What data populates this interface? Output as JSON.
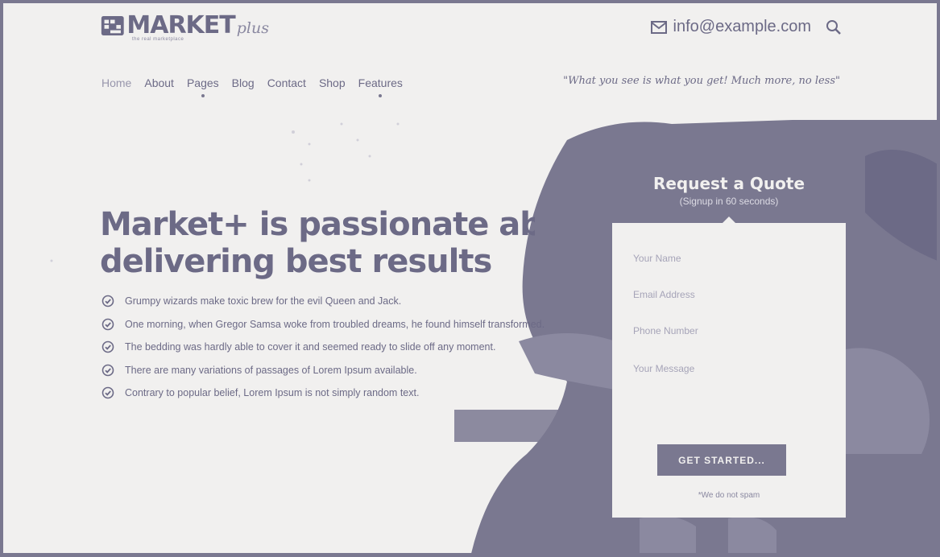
{
  "header": {
    "logo_text": "MARKET",
    "logo_suffix": "plus",
    "logo_tagline": "the real marketplace",
    "email": "info@example.com",
    "tagline": "\"What you see is what you get! Much more, no less\""
  },
  "nav": {
    "items": [
      {
        "label": "Home",
        "has_dropdown": false
      },
      {
        "label": "About",
        "has_dropdown": false
      },
      {
        "label": "Pages",
        "has_dropdown": true
      },
      {
        "label": "Blog",
        "has_dropdown": false
      },
      {
        "label": "Contact",
        "has_dropdown": false
      },
      {
        "label": "Shop",
        "has_dropdown": false
      },
      {
        "label": "Features",
        "has_dropdown": true
      }
    ]
  },
  "hero": {
    "headline_line1": "Market+ is passionate about",
    "headline_line2": "delivering best results",
    "features": [
      "Grumpy wizards make toxic brew for the evil Queen and Jack.",
      "One morning, when Gregor Samsa woke from troubled dreams, he found himself transformed.",
      "The bedding was hardly able to cover it and seemed ready to slide off any moment.",
      "There are many variations of passages of Lorem Ipsum available.",
      "Contrary to popular belief, Lorem Ipsum is not simply random text."
    ]
  },
  "quote_form": {
    "title": "Request a Quote",
    "subtitle": "(Signup in 60 seconds)",
    "name_placeholder": "Your Name",
    "email_placeholder": "Email Address",
    "phone_placeholder": "Phone Number",
    "message_placeholder": "Your Message",
    "submit_label": "GET STARTED...",
    "note": "*We do not spam"
  },
  "colors": {
    "background": "#f1f0ef",
    "primary": "#6c6a86",
    "accent_dark": "#7a7890"
  },
  "icons": [
    "mail-icon",
    "search-icon",
    "check-circle-icon"
  ]
}
